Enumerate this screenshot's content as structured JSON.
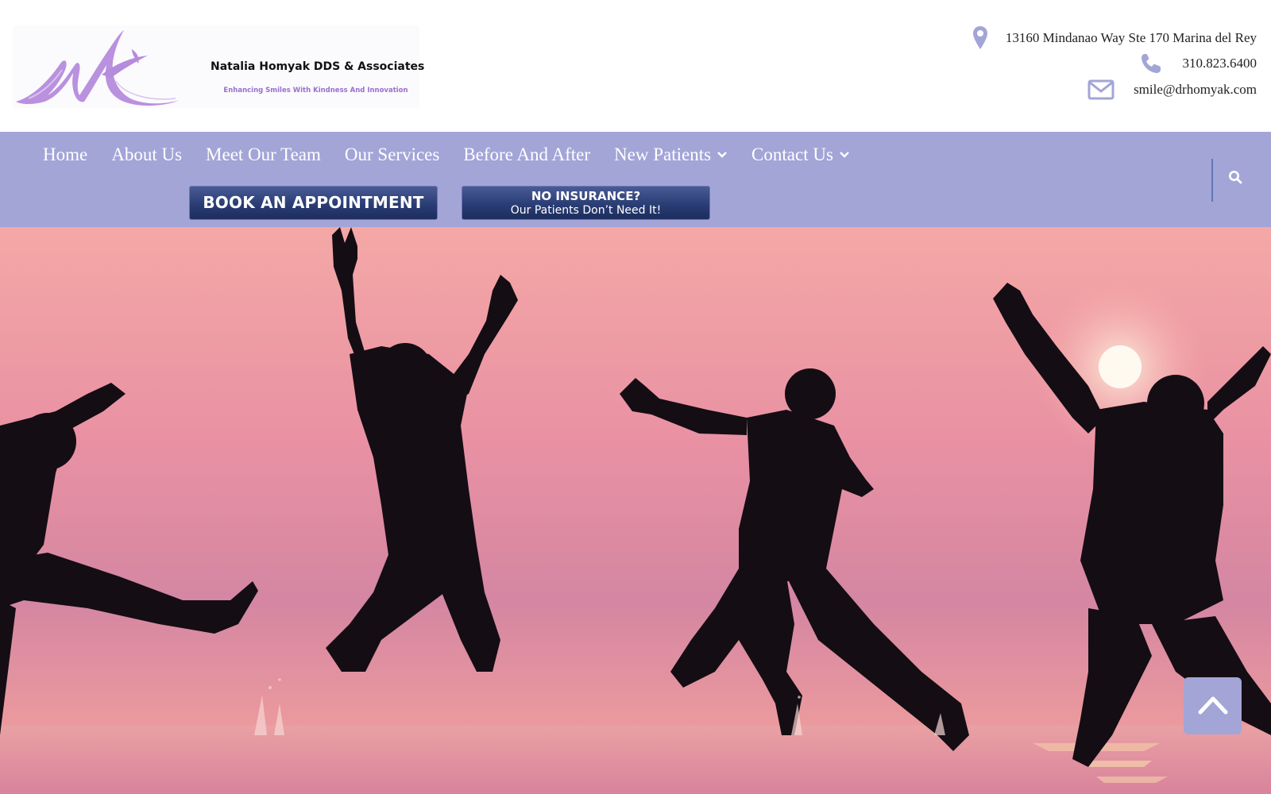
{
  "brand": {
    "name": "Natalia Homyak DDS & Associates",
    "tagline": "Enhancing Smiles With Kindness And Innovation",
    "logo_color": "#b58bdd"
  },
  "contact": {
    "address": "13160 Mindanao Way Ste 170 Marina del Rey",
    "phone": "310.823.6400",
    "email": "smile@drhomyak.com",
    "address_icon": "map-pin-icon",
    "phone_icon": "phone-icon",
    "email_icon": "envelope-icon",
    "icon_color": "#a3a5d7"
  },
  "nav": {
    "items": [
      {
        "label": "Home",
        "has_dropdown": false
      },
      {
        "label": "About Us",
        "has_dropdown": false
      },
      {
        "label": "Meet Our Team",
        "has_dropdown": false
      },
      {
        "label": "Our Services",
        "has_dropdown": false
      },
      {
        "label": "Before And After",
        "has_dropdown": false
      },
      {
        "label": "New Patients",
        "has_dropdown": true
      },
      {
        "label": "Contact Us",
        "has_dropdown": true
      }
    ],
    "bar_color": "#a3a5d7",
    "search_icon": "search-icon"
  },
  "buttons": {
    "book": "BOOK AN APPOINTMENT",
    "insurance_line1": "NO INSURANCE?",
    "insurance_line2": "Our Patients Don’t Need It!",
    "button_color": "#2a3d75"
  },
  "hero": {
    "description_icon": "jumping-people-silhouette",
    "back_to_top_icon": "chevron-up-icon"
  }
}
